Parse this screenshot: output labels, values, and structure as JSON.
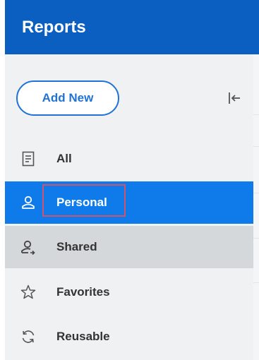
{
  "header": {
    "title": "Reports"
  },
  "actions": {
    "add_new_label": "Add New",
    "collapse_icon": "collapse-left-icon"
  },
  "nav": {
    "items": [
      {
        "label": "All",
        "icon": "document-icon",
        "state": "default"
      },
      {
        "label": "Personal",
        "icon": "person-icon",
        "state": "selected"
      },
      {
        "label": "Shared",
        "icon": "shared-person-icon",
        "state": "hover"
      },
      {
        "label": "Favorites",
        "icon": "star-icon",
        "state": "default"
      },
      {
        "label": "Reusable",
        "icon": "refresh-icon",
        "state": "default"
      }
    ]
  },
  "colors": {
    "header_bg": "#0b5fc1",
    "accent": "#1f73d6",
    "selected_bg": "#0f7bea",
    "hover_bg": "#d5d8db",
    "panel_bg": "#f0f1f2",
    "annotation_box": "#d0546c"
  }
}
